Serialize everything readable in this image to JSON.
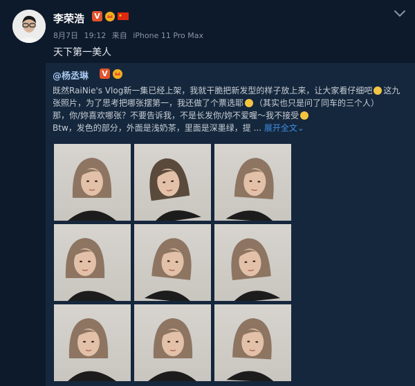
{
  "author": {
    "name": "李荣浩",
    "badge_v": "V"
  },
  "meta": {
    "date": "8月7日",
    "time": "19:12",
    "source_prefix": "来自",
    "device": "iPhone 11 Pro Max"
  },
  "post": {
    "text": "天下第一美人"
  },
  "repost": {
    "author": "@杨丞琳",
    "badge_v": "V",
    "line1": "既然RaiNie's Vlog新一集已经上架，我就干脆把新发型的样子放上来，让大家看仔细吧",
    "line1_tail": "这九张照片，为了思考把哪张摆第一，我还做了个票选耶",
    "line1_end": "（其实也只是问了同车的三个人）",
    "line2": "那，你/妳喜欢哪张？不要告诉我，不是长发你/妳不爱喔～我不接受",
    "line3": "Btw，发色的部分，外面是浅奶茶，里面是深墨绿，提 ...",
    "expand_label": "展开全文",
    "expand_glyph": "⌄"
  },
  "photos": [
    {
      "name": "photo-1"
    },
    {
      "name": "photo-2"
    },
    {
      "name": "photo-3"
    },
    {
      "name": "photo-4"
    },
    {
      "name": "photo-5"
    },
    {
      "name": "photo-6"
    },
    {
      "name": "photo-7"
    },
    {
      "name": "photo-8"
    },
    {
      "name": "photo-9"
    }
  ],
  "colors": {
    "background": "#0d1a2b",
    "repost_background": "#15273c",
    "link": "#3e8fe6",
    "badge": "#e2542c"
  },
  "icons": {
    "chevron": "chevron-down-icon",
    "crown": "crown-icon",
    "flag": "china-flag-icon"
  }
}
